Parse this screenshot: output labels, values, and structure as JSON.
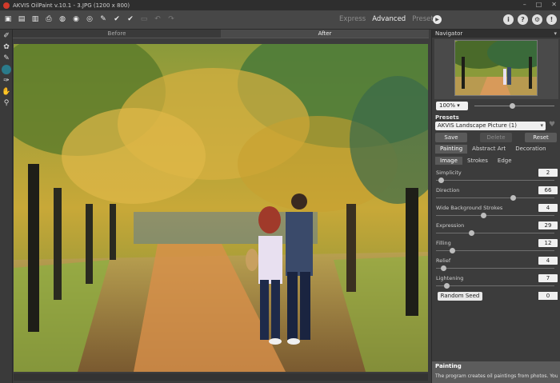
{
  "window": {
    "title": "AKVIS OilPaint v.10.1 - 3.JPG (1200 x 800)",
    "minimize": "–",
    "maximize": "□",
    "close": "✕"
  },
  "toolbar": {
    "icons": [
      "open-icon",
      "save-icon",
      "save-as-icon",
      "print-icon",
      "batch-icon",
      "import-icon",
      "export-icon",
      "brush-icon",
      "apply-icon",
      "run-icon",
      "undo-icon",
      "redo-icon"
    ],
    "modes": [
      "Express",
      "Advanced",
      "Presets"
    ],
    "active_mode": "Advanced",
    "right_icons": [
      "info-icon",
      "help-icon",
      "settings-icon",
      "share-icon"
    ]
  },
  "tools": [
    "eraser-icon",
    "clone-icon",
    "brush-icon",
    "circle-icon",
    "stroke-icon",
    "hand-icon",
    "zoom-icon"
  ],
  "view_tabs": {
    "before": "Before",
    "after": "After"
  },
  "navigator": {
    "title": "Navigator",
    "zoom": "100%"
  },
  "presets": {
    "label": "Presets",
    "selected": "AKVIS Landscape Picture (1)",
    "save": "Save",
    "delete": "Delete",
    "reset": "Reset"
  },
  "tabs": [
    "Painting",
    "Abstract Art",
    "Decoration"
  ],
  "active_tab": "Painting",
  "subtabs": [
    "Image",
    "Strokes",
    "Edge"
  ],
  "active_subtab": "Image",
  "params": [
    {
      "label": "Simplicity",
      "value": "2",
      "fraction": 0.02
    },
    {
      "label": "Direction",
      "value": "66",
      "fraction": 0.66
    },
    {
      "label": "Wide Background Strokes",
      "value": "4",
      "fraction": 0.4
    },
    {
      "label": "Expression",
      "value": "29",
      "fraction": 0.29
    },
    {
      "label": "Filling",
      "value": "12",
      "fraction": 0.12
    },
    {
      "label": "Relief",
      "value": "4",
      "fraction": 0.04
    },
    {
      "label": "Lightening",
      "value": "7",
      "fraction": 0.07
    }
  ],
  "random_seed": {
    "label": "Random Seed",
    "value": "0"
  },
  "help": {
    "title": "Painting",
    "text": "The program creates oil paintings from photos. You can adjust the effect parameters in the Painting"
  }
}
